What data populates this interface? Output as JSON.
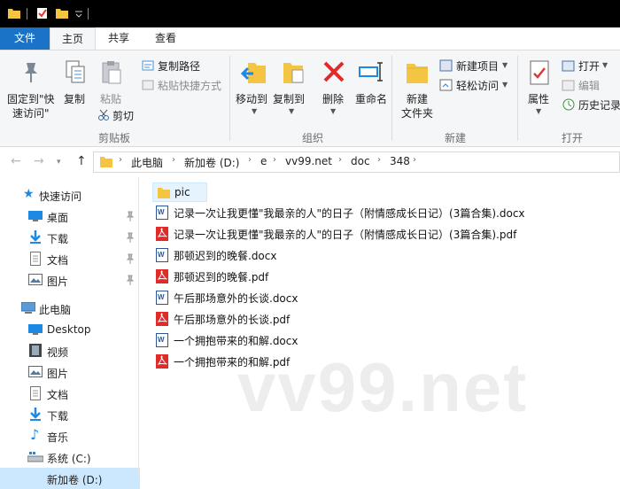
{
  "ribbon_tabs": [
    "文件",
    "主页",
    "共享",
    "查看"
  ],
  "ribbon": {
    "pin_label_1": "固定到\"快",
    "pin_label_2": "速访问\"",
    "copy": "复制",
    "paste": "粘贴",
    "copy_path": "复制路径",
    "paste_shortcut": "粘贴快捷方式",
    "cut": "剪切",
    "group_clipboard": "剪贴板",
    "move_to": "移动到",
    "copy_to": "复制到",
    "delete": "删除",
    "rename": "重命名",
    "group_organize": "组织",
    "new_folder_1": "新建",
    "new_folder_2": "文件夹",
    "new_item": "新建项目",
    "easy_access": "轻松访问",
    "group_new": "新建",
    "properties": "属性",
    "open": "打开",
    "edit": "编辑",
    "history": "历史记录",
    "group_open": "打开"
  },
  "breadcrumb": [
    "此电脑",
    "新加卷 (D:)",
    "e",
    "vv99.net",
    "doc",
    "348"
  ],
  "nav_pane": {
    "quick_access": "快速访问",
    "quick_items": [
      "桌面",
      "下载",
      "文档",
      "图片"
    ],
    "this_pc": "此电脑",
    "pc_items": [
      "Desktop",
      "视频",
      "图片",
      "文档",
      "下载",
      "音乐",
      "系统 (C:)",
      "新加卷 (D:)"
    ]
  },
  "files": [
    {
      "name": "pic",
      "type": "folder"
    },
    {
      "name": "记录一次让我更懂\"我最亲的人\"的日子（附情感成长日记）(3篇合集).docx",
      "type": "docx"
    },
    {
      "name": "记录一次让我更懂\"我最亲的人\"的日子（附情感成长日记）(3篇合集).pdf",
      "type": "pdf"
    },
    {
      "name": "那顿迟到的晚餐.docx",
      "type": "docx"
    },
    {
      "name": "那顿迟到的晚餐.pdf",
      "type": "pdf"
    },
    {
      "name": "午后那场意外的长谈.docx",
      "type": "docx"
    },
    {
      "name": "午后那场意外的长谈.pdf",
      "type": "pdf"
    },
    {
      "name": "一个拥抱带来的和解.docx",
      "type": "docx"
    },
    {
      "name": "一个拥抱带来的和解.pdf",
      "type": "pdf"
    }
  ],
  "watermark": "vv99.net",
  "colors": {
    "accent": "#1a73c7",
    "folder": "#f4c542",
    "pdf_red": "#e02b2b",
    "word_blue": "#2b579a",
    "selection": "#cce8ff"
  }
}
